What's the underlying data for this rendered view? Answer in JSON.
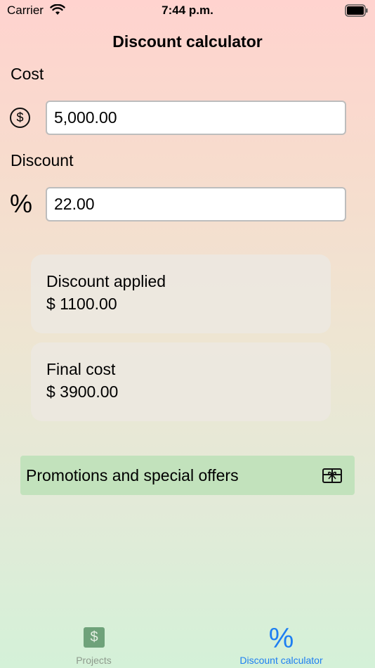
{
  "status_bar": {
    "carrier": "Carrier",
    "time": "7:44 p.m."
  },
  "nav": {
    "title": "Discount calculator"
  },
  "cost": {
    "label": "Cost",
    "icon": "dollar-circle-icon",
    "value": "5,000.00"
  },
  "discount": {
    "label": "Discount",
    "icon": "percent-icon",
    "value": "22.00"
  },
  "results": {
    "discount_applied": {
      "title": "Discount applied",
      "value": "$ 1100.00"
    },
    "final_cost": {
      "title": "Final cost",
      "value": "$ 3900.00"
    }
  },
  "promo": {
    "label": "Promotions and special offers",
    "icon": "gift-card-icon"
  },
  "tabs": [
    {
      "label": "Projects",
      "icon": "dollar-square-icon",
      "glyph": "$",
      "selected": false
    },
    {
      "label": "Discount calculator",
      "icon": "percent-icon",
      "glyph": "%",
      "selected": true
    }
  ],
  "colors": {
    "accent": "#1d7ef2",
    "promo_background": "#c2e2bc",
    "inactive_tab": "#8e9a8d"
  }
}
